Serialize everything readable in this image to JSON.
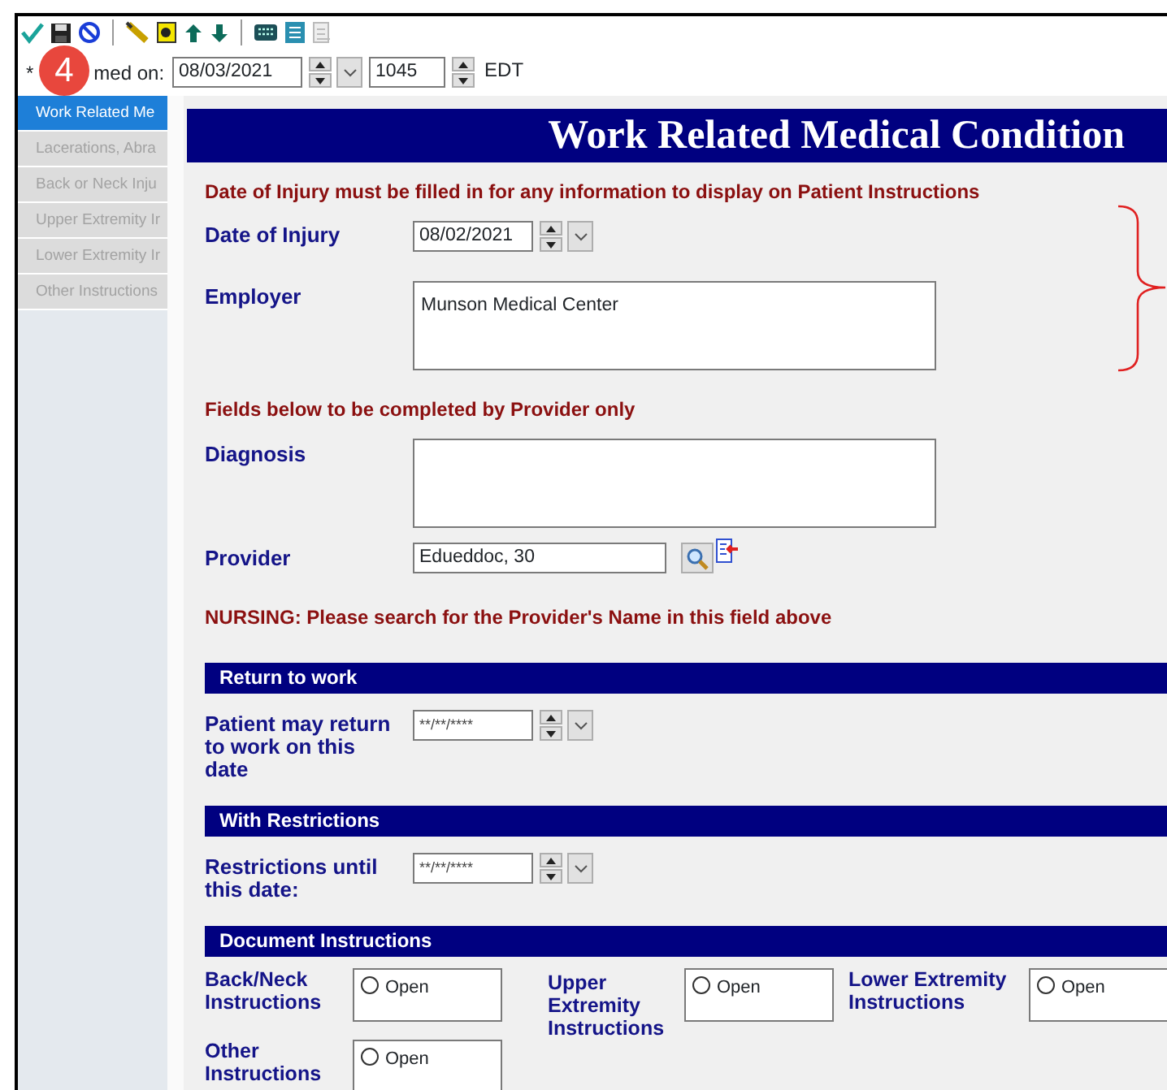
{
  "annotation_badge": "4",
  "performed_on": {
    "label_start": "*",
    "label_end": "med on:",
    "date": "08/03/2021",
    "time": "1045",
    "zone": "EDT"
  },
  "sidebar": {
    "items": [
      {
        "label": "Work Related Me",
        "selected": true,
        "disabled": false
      },
      {
        "label": "Lacerations, Abra",
        "selected": false,
        "disabled": true
      },
      {
        "label": "Back or Neck Inju",
        "selected": false,
        "disabled": true
      },
      {
        "label": "Upper Extremity Ir",
        "selected": false,
        "disabled": true
      },
      {
        "label": "Lower Extremity Ir",
        "selected": false,
        "disabled": true
      },
      {
        "label": "Other Instructions",
        "selected": false,
        "disabled": true
      }
    ]
  },
  "form": {
    "title": "Work Related Medical Condition",
    "items": [
      {
        "kind": "notice",
        "text": "Date of Injury must be filled in for any information to display on Patient Instructions"
      },
      {
        "kind": "date",
        "label": "Date of Injury",
        "value": "08/02/2021"
      },
      {
        "kind": "textarea",
        "label": "Employer",
        "value": "Munson Medical Center"
      },
      {
        "kind": "notice",
        "text": "Fields below to be completed by Provider only"
      },
      {
        "kind": "textarea",
        "label": "Diagnosis"
      },
      {
        "kind": "lookup",
        "label": "Provider",
        "value": "Edueddoc, 30"
      },
      {
        "kind": "notice",
        "text": "NURSING: Please search for the Provider's Name in this field above"
      },
      {
        "kind": "header",
        "text": "Return to work"
      },
      {
        "kind": "date",
        "label": "Patient may return to work on this date",
        "value": "**/**/****"
      },
      {
        "kind": "header",
        "text": "With Restrictions"
      },
      {
        "kind": "date",
        "label": "Restrictions until this date:",
        "value": "**/**/****"
      },
      {
        "kind": "header",
        "text": "Document Instructions"
      },
      {
        "kind": "instructions",
        "entries": [
          {
            "label": "Back/Neck Instructions",
            "option": "Open",
            "checked": false
          },
          {
            "label": "Upper Extremity Instructions",
            "option": "Open",
            "checked": false
          },
          {
            "label": "Lower Extremity Instructions",
            "option": "Open",
            "checked": false
          },
          {
            "label": "Other Instructions",
            "option": "Open",
            "checked": false
          }
        ]
      }
    ]
  }
}
